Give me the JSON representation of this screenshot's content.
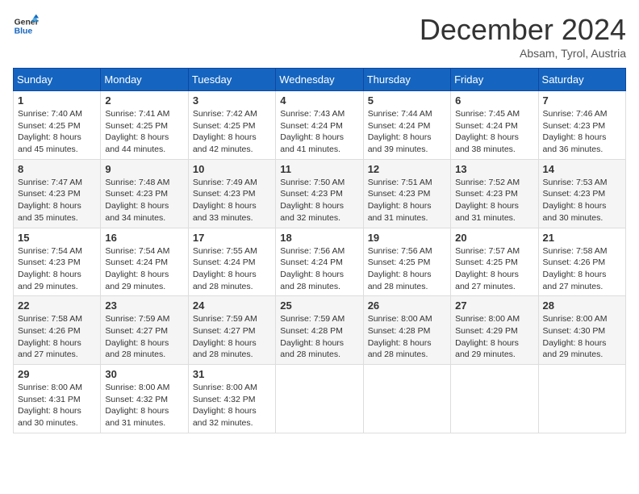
{
  "header": {
    "logo_general": "General",
    "logo_blue": "Blue",
    "month": "December 2024",
    "location": "Absam, Tyrol, Austria"
  },
  "weekdays": [
    "Sunday",
    "Monday",
    "Tuesday",
    "Wednesday",
    "Thursday",
    "Friday",
    "Saturday"
  ],
  "weeks": [
    [
      {
        "day": "1",
        "sunrise": "7:40 AM",
        "sunset": "4:25 PM",
        "daylight": "8 hours and 45 minutes."
      },
      {
        "day": "2",
        "sunrise": "7:41 AM",
        "sunset": "4:25 PM",
        "daylight": "8 hours and 44 minutes."
      },
      {
        "day": "3",
        "sunrise": "7:42 AM",
        "sunset": "4:25 PM",
        "daylight": "8 hours and 42 minutes."
      },
      {
        "day": "4",
        "sunrise": "7:43 AM",
        "sunset": "4:24 PM",
        "daylight": "8 hours and 41 minutes."
      },
      {
        "day": "5",
        "sunrise": "7:44 AM",
        "sunset": "4:24 PM",
        "daylight": "8 hours and 39 minutes."
      },
      {
        "day": "6",
        "sunrise": "7:45 AM",
        "sunset": "4:24 PM",
        "daylight": "8 hours and 38 minutes."
      },
      {
        "day": "7",
        "sunrise": "7:46 AM",
        "sunset": "4:23 PM",
        "daylight": "8 hours and 36 minutes."
      }
    ],
    [
      {
        "day": "8",
        "sunrise": "7:47 AM",
        "sunset": "4:23 PM",
        "daylight": "8 hours and 35 minutes."
      },
      {
        "day": "9",
        "sunrise": "7:48 AM",
        "sunset": "4:23 PM",
        "daylight": "8 hours and 34 minutes."
      },
      {
        "day": "10",
        "sunrise": "7:49 AM",
        "sunset": "4:23 PM",
        "daylight": "8 hours and 33 minutes."
      },
      {
        "day": "11",
        "sunrise": "7:50 AM",
        "sunset": "4:23 PM",
        "daylight": "8 hours and 32 minutes."
      },
      {
        "day": "12",
        "sunrise": "7:51 AM",
        "sunset": "4:23 PM",
        "daylight": "8 hours and 31 minutes."
      },
      {
        "day": "13",
        "sunrise": "7:52 AM",
        "sunset": "4:23 PM",
        "daylight": "8 hours and 31 minutes."
      },
      {
        "day": "14",
        "sunrise": "7:53 AM",
        "sunset": "4:23 PM",
        "daylight": "8 hours and 30 minutes."
      }
    ],
    [
      {
        "day": "15",
        "sunrise": "7:54 AM",
        "sunset": "4:23 PM",
        "daylight": "8 hours and 29 minutes."
      },
      {
        "day": "16",
        "sunrise": "7:54 AM",
        "sunset": "4:24 PM",
        "daylight": "8 hours and 29 minutes."
      },
      {
        "day": "17",
        "sunrise": "7:55 AM",
        "sunset": "4:24 PM",
        "daylight": "8 hours and 28 minutes."
      },
      {
        "day": "18",
        "sunrise": "7:56 AM",
        "sunset": "4:24 PM",
        "daylight": "8 hours and 28 minutes."
      },
      {
        "day": "19",
        "sunrise": "7:56 AM",
        "sunset": "4:25 PM",
        "daylight": "8 hours and 28 minutes."
      },
      {
        "day": "20",
        "sunrise": "7:57 AM",
        "sunset": "4:25 PM",
        "daylight": "8 hours and 27 minutes."
      },
      {
        "day": "21",
        "sunrise": "7:58 AM",
        "sunset": "4:26 PM",
        "daylight": "8 hours and 27 minutes."
      }
    ],
    [
      {
        "day": "22",
        "sunrise": "7:58 AM",
        "sunset": "4:26 PM",
        "daylight": "8 hours and 27 minutes."
      },
      {
        "day": "23",
        "sunrise": "7:59 AM",
        "sunset": "4:27 PM",
        "daylight": "8 hours and 28 minutes."
      },
      {
        "day": "24",
        "sunrise": "7:59 AM",
        "sunset": "4:27 PM",
        "daylight": "8 hours and 28 minutes."
      },
      {
        "day": "25",
        "sunrise": "7:59 AM",
        "sunset": "4:28 PM",
        "daylight": "8 hours and 28 minutes."
      },
      {
        "day": "26",
        "sunrise": "8:00 AM",
        "sunset": "4:28 PM",
        "daylight": "8 hours and 28 minutes."
      },
      {
        "day": "27",
        "sunrise": "8:00 AM",
        "sunset": "4:29 PM",
        "daylight": "8 hours and 29 minutes."
      },
      {
        "day": "28",
        "sunrise": "8:00 AM",
        "sunset": "4:30 PM",
        "daylight": "8 hours and 29 minutes."
      }
    ],
    [
      {
        "day": "29",
        "sunrise": "8:00 AM",
        "sunset": "4:31 PM",
        "daylight": "8 hours and 30 minutes."
      },
      {
        "day": "30",
        "sunrise": "8:00 AM",
        "sunset": "4:32 PM",
        "daylight": "8 hours and 31 minutes."
      },
      {
        "day": "31",
        "sunrise": "8:00 AM",
        "sunset": "4:32 PM",
        "daylight": "8 hours and 32 minutes."
      },
      null,
      null,
      null,
      null
    ]
  ]
}
